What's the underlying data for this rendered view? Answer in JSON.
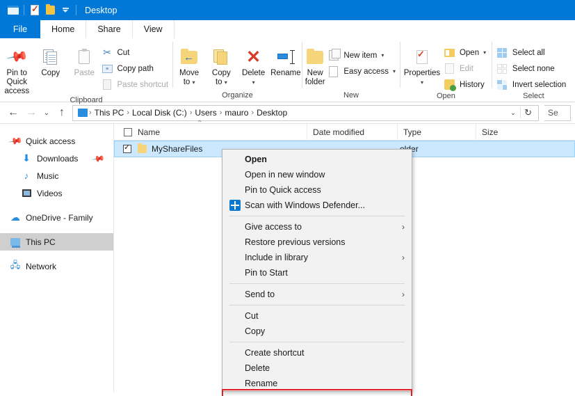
{
  "window": {
    "title": "Desktop",
    "quick_access_toolbar": [
      {
        "name": "window-menu-icon",
        "label": "Desktop"
      },
      {
        "name": "properties-icon",
        "label": "Properties"
      },
      {
        "name": "new-folder-icon",
        "label": "New folder"
      },
      {
        "name": "customize-qat-caret",
        "label": "Customize Quick Access Toolbar"
      }
    ]
  },
  "ribbon": {
    "tabs": [
      {
        "label": "File",
        "active": false
      },
      {
        "label": "Home",
        "active": true
      },
      {
        "label": "Share",
        "active": false
      },
      {
        "label": "View",
        "active": false
      }
    ],
    "groups": [
      {
        "label": "Clipboard",
        "big_buttons": [
          {
            "label_line1": "Pin to Quick",
            "label_line2": "access",
            "icon": "pin-icon",
            "disabled": false
          },
          {
            "label_line1": "Copy",
            "label_line2": "",
            "icon": "copy-icon",
            "disabled": false
          },
          {
            "label_line1": "Paste",
            "label_line2": "",
            "icon": "paste-icon",
            "disabled": true
          }
        ],
        "small_buttons": [
          {
            "label": "Cut",
            "icon": "scissors-icon",
            "disabled": false
          },
          {
            "label": "Copy path",
            "icon": "copy-path-icon",
            "disabled": false
          },
          {
            "label": "Paste shortcut",
            "icon": "paste-shortcut-icon",
            "disabled": true
          }
        ]
      },
      {
        "label": "Organize",
        "big_buttons": [
          {
            "label_line1": "Move",
            "label_line2": "to",
            "icon": "move-to-icon",
            "dropdown": true
          },
          {
            "label_line1": "Copy",
            "label_line2": "to",
            "icon": "copy-to-icon",
            "dropdown": true
          },
          {
            "label_line1": "Delete",
            "label_line2": "",
            "icon": "delete-icon",
            "dropdown": true
          },
          {
            "label_line1": "Rename",
            "label_line2": "",
            "icon": "rename-icon",
            "dropdown": false
          }
        ],
        "small_buttons": []
      },
      {
        "label": "New",
        "big_buttons": [
          {
            "label_line1": "New",
            "label_line2": "folder",
            "icon": "new-folder-icon",
            "dropdown": false
          }
        ],
        "small_buttons": [
          {
            "label": "New item",
            "icon": "new-item-icon",
            "dropdown": true
          },
          {
            "label": "Easy access",
            "icon": "easy-access-icon",
            "dropdown": true
          }
        ]
      },
      {
        "label": "Open",
        "big_buttons": [
          {
            "label_line1": "Properties",
            "label_line2": "",
            "icon": "properties-icon",
            "dropdown": true
          }
        ],
        "small_buttons": [
          {
            "label": "Open",
            "icon": "open-icon",
            "dropdown": true,
            "disabled": false
          },
          {
            "label": "Edit",
            "icon": "edit-icon",
            "dropdown": false,
            "disabled": true
          },
          {
            "label": "History",
            "icon": "history-icon",
            "dropdown": false,
            "disabled": false
          }
        ]
      },
      {
        "label": "Select",
        "big_buttons": [],
        "small_buttons": [
          {
            "label": "Select all",
            "icon": "select-all-icon"
          },
          {
            "label": "Select none",
            "icon": "select-none-icon"
          },
          {
            "label": "Invert selection",
            "icon": "invert-selection-icon"
          }
        ]
      }
    ]
  },
  "address_bar": {
    "back_icon": "back-arrow-icon",
    "forward_icon": "forward-arrow-icon",
    "recent_icon": "recent-locations-icon",
    "up_icon": "up-arrow-icon",
    "breadcrumbs": [
      "This PC",
      "Local Disk (C:)",
      "Users",
      "mauro",
      "Desktop"
    ],
    "separator": "›",
    "dropdown_icon": "chevron-down-icon",
    "refresh_icon": "refresh-icon",
    "search_text": "Se"
  },
  "nav_pane": {
    "items": [
      {
        "label": "Quick access",
        "icon": "quick-access-pin-icon",
        "indent": false,
        "selected": false,
        "pinned": false
      },
      {
        "label": "Downloads",
        "icon": "downloads-icon",
        "indent": true,
        "selected": false,
        "pinned": true
      },
      {
        "label": "Music",
        "icon": "music-icon",
        "indent": true,
        "selected": false,
        "pinned": false
      },
      {
        "label": "Videos",
        "icon": "videos-icon",
        "indent": true,
        "selected": false,
        "pinned": false
      },
      {
        "label": "OneDrive - Family",
        "icon": "onedrive-icon",
        "indent": false,
        "selected": false,
        "pinned": false
      },
      {
        "label": "This PC",
        "icon": "this-pc-icon",
        "indent": false,
        "selected": true,
        "pinned": false
      },
      {
        "label": "Network",
        "icon": "network-icon",
        "indent": false,
        "selected": false,
        "pinned": false
      }
    ]
  },
  "file_list": {
    "columns": [
      "Name",
      "Date modified",
      "Type",
      "Size"
    ],
    "sort_indicator": "⌃",
    "rows": [
      {
        "name": "MyShareFiles",
        "date_modified": "",
        "type": "File folder",
        "type_visible": "older",
        "size": "",
        "checked": true,
        "selected": true
      }
    ]
  },
  "context_menu": {
    "items": [
      {
        "label": "Open",
        "bold": true,
        "icon": null,
        "submenu": false,
        "separator_after": false
      },
      {
        "label": "Open in new window",
        "bold": false,
        "icon": null,
        "submenu": false,
        "separator_after": false
      },
      {
        "label": "Pin to Quick access",
        "bold": false,
        "icon": null,
        "submenu": false,
        "separator_after": false
      },
      {
        "label": "Scan with Windows Defender...",
        "bold": false,
        "icon": "windows-defender-icon",
        "submenu": false,
        "separator_after": true
      },
      {
        "label": "Give access to",
        "bold": false,
        "icon": null,
        "submenu": true,
        "separator_after": false
      },
      {
        "label": "Restore previous versions",
        "bold": false,
        "icon": null,
        "submenu": false,
        "separator_after": false
      },
      {
        "label": "Include in library",
        "bold": false,
        "icon": null,
        "submenu": true,
        "separator_after": false
      },
      {
        "label": "Pin to Start",
        "bold": false,
        "icon": null,
        "submenu": false,
        "separator_after": true
      },
      {
        "label": "Send to",
        "bold": false,
        "icon": null,
        "submenu": true,
        "separator_after": true
      },
      {
        "label": "Cut",
        "bold": false,
        "icon": null,
        "submenu": false,
        "separator_after": false
      },
      {
        "label": "Copy",
        "bold": false,
        "icon": null,
        "submenu": false,
        "separator_after": true
      },
      {
        "label": "Create shortcut",
        "bold": false,
        "icon": null,
        "submenu": false,
        "separator_after": false
      },
      {
        "label": "Delete",
        "bold": false,
        "icon": null,
        "submenu": false,
        "separator_after": false
      },
      {
        "label": "Rename",
        "bold": false,
        "icon": null,
        "submenu": false,
        "separator_after": false
      }
    ],
    "submenu_arrow": "›"
  },
  "annotation": {
    "highlight_color": "#e02020",
    "shape": "rectangle"
  },
  "colors": {
    "accent": "#0078d7",
    "selection": "#cce8ff",
    "nav_selected": "#cfcfcf",
    "menu_bg": "#f2f2f2",
    "folder": "#f6d479"
  }
}
